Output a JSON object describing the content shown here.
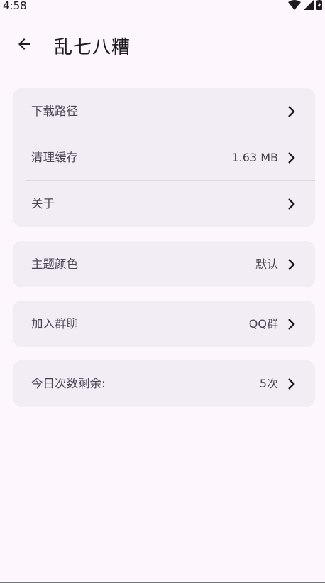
{
  "status_bar": {
    "time": "4:58",
    "icons": [
      "wifi-icon",
      "cell-signal-icon",
      "battery-charging-icon"
    ]
  },
  "app_bar": {
    "back_icon": "arrow-left-icon",
    "title": "乱七八糟"
  },
  "groups": [
    {
      "rows": [
        {
          "label": "下载路径",
          "value": ""
        },
        {
          "label": "清理缓存",
          "value": "1.63 MB"
        },
        {
          "label": "关于",
          "value": ""
        }
      ]
    },
    {
      "rows": [
        {
          "label": "主题颜色",
          "value": "默认"
        }
      ]
    },
    {
      "rows": [
        {
          "label": "加入群聊",
          "value": "QQ群"
        }
      ]
    },
    {
      "rows": [
        {
          "label": "今日次数剩余:",
          "value": "5次"
        }
      ]
    }
  ],
  "colors": {
    "background": "#fdf7fd",
    "card": "#f2edf5",
    "text_primary": "#1d1b20",
    "text_secondary": "#49454f"
  }
}
